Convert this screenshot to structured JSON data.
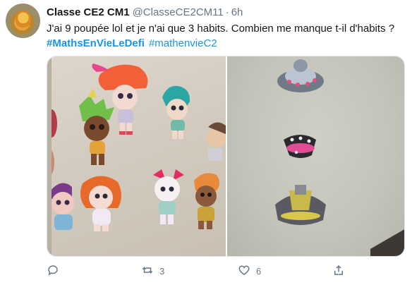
{
  "tweet": {
    "author_name": "Classe CE2 CM1",
    "handle": "@ClasseCE2CM11",
    "separator": "·",
    "time": "6h",
    "text": "J'ai 9 poupée lol et je n'ai que 3 habits. Combien me manque t-il d'habits ?",
    "hashtags": [
      "#MathsEnVieLeDefi",
      "#mathenvieC2"
    ]
  },
  "actions": {
    "reply_count": "",
    "retweet_count": "3",
    "like_count": "6"
  },
  "icons": {
    "reply": "reply-icon",
    "retweet": "retweet-icon",
    "like": "heart-icon",
    "share": "share-icon"
  },
  "colors": {
    "link": "#1b95e0",
    "secondary_text": "#657786",
    "primary_text": "#14171a"
  }
}
